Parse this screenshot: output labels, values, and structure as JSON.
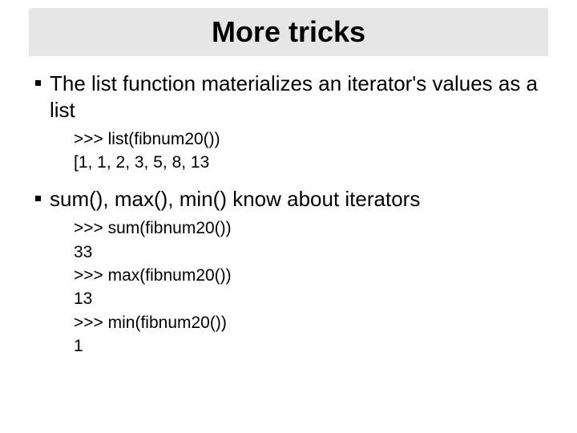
{
  "title": "More tricks",
  "bullets": [
    {
      "text": "The list function materializes an iterator's values as a list",
      "code": [
        ">>> list(fibnum20())",
        "[1, 1, 2, 3, 5, 8, 13"
      ]
    },
    {
      "text": "sum(), max(), min() know about iterators",
      "code": [
        ">>> sum(fibnum20())",
        "33",
        ">>> max(fibnum20())",
        "13",
        ">>> min(fibnum20())",
        "1"
      ]
    }
  ]
}
